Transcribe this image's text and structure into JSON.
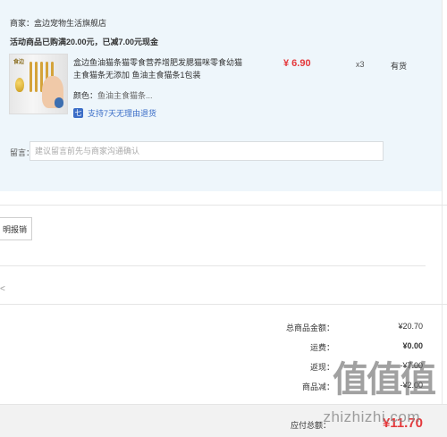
{
  "shop": {
    "label": "商家：",
    "name": "盒边宠物生活旗舰店"
  },
  "promo": {
    "text": "活动商品已购满20.00元，已减7.00元现金"
  },
  "item": {
    "image_logo": "食边",
    "title": "盒边鱼油猫条猫零食营养增肥发腮猫咪零食幼猫主食猫条无添加 鱼油主食猫条1包装",
    "price": "¥ 6.90",
    "quantity": "x3",
    "stock": "有货",
    "variant_label": "颜色：",
    "variant_value": "鱼油主食猫条...",
    "return_icon": "七",
    "return_text": "支持7天无理由退货"
  },
  "note": {
    "label": "留言：",
    "placeholder": "建议留言前先与商家沟通确认"
  },
  "invoice": {
    "button_label": "明报销"
  },
  "scroll_glyph": "<",
  "summary": {
    "rows": [
      {
        "label": "总商品金额：",
        "value": "¥20.70"
      },
      {
        "label": "运费：",
        "value": "¥0.00"
      },
      {
        "label": "返现：",
        "value": "-¥7.00"
      },
      {
        "label": "商品减：",
        "value": "-¥2.00"
      }
    ]
  },
  "payable": {
    "label": "应付总额：",
    "value": "¥11.70"
  },
  "watermark": {
    "mark": "值值值",
    "url": "zhizhizhi.com"
  },
  "colors": {
    "price_red": "#e4393c",
    "link_blue": "#3b6dc7",
    "panel_bg": "#eef6fb"
  }
}
